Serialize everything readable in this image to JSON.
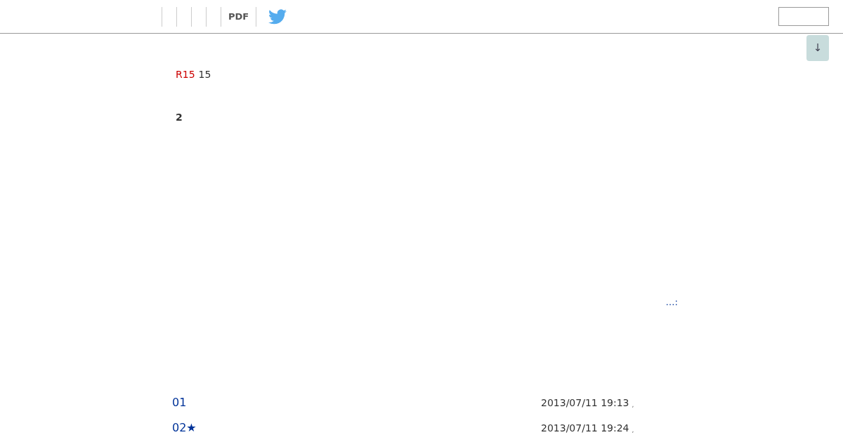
{
  "nav": {
    "pdf_label": "PDF"
  },
  "novel": {
    "rating_tag": "R15",
    "rating_age": "15",
    "chapter_count": "2",
    "more_link": "…:"
  },
  "episodes": [
    {
      "title": "01",
      "date": "2013/07/11 19:13",
      "mark": ","
    },
    {
      "title": "02★",
      "date": "2013/07/11 19:24",
      "mark": ","
    }
  ],
  "scroll_button": "↓"
}
